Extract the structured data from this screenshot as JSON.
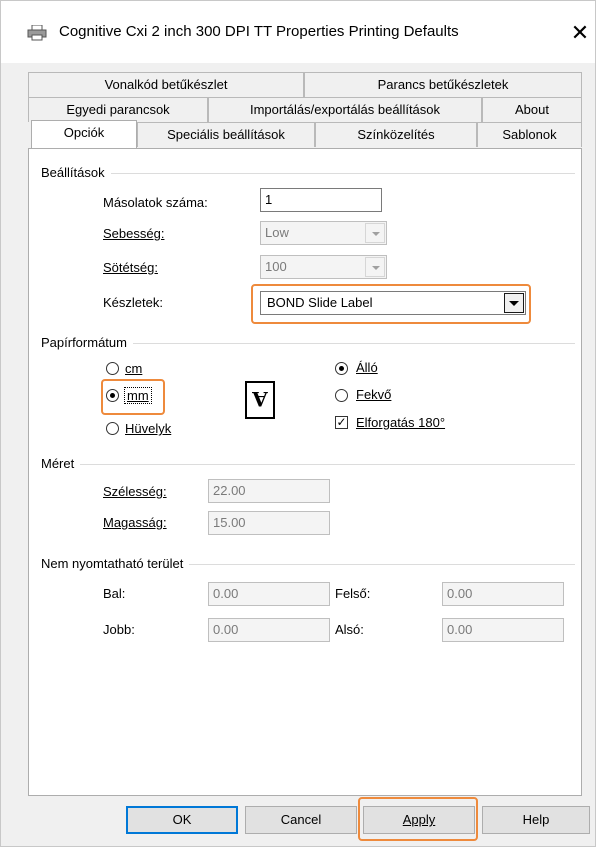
{
  "window": {
    "title": "Cognitive Cxi 2 inch 300 DPI TT Properties Printing Defaults",
    "close_glyph": "✕",
    "icon": "printer-icon"
  },
  "tabs": {
    "row1": [
      "Vonalkód betűkészlet",
      "Parancs betűkészletek"
    ],
    "row2": [
      "Egyedi parancsok",
      "Importálás/exportálás beállítások",
      "About"
    ],
    "row3": [
      "Opciók",
      "Speciális beállítások",
      "Színközelítés",
      "Sablonok"
    ],
    "active": "Opciók"
  },
  "settings": {
    "group_title": "Beállítások",
    "copies_label": "Másolatok száma:",
    "copies_value": "1",
    "speed_label": "Sebesség:",
    "speed_value": "Low",
    "darkness_label": "Sötétség:",
    "darkness_value": "100",
    "stocks_label": "Készletek:",
    "stocks_value": "BOND Slide Label"
  },
  "paper": {
    "group_title": "Papírformátum",
    "unit_cm": "cm",
    "unit_mm": "mm",
    "unit_inch": "Hüvelyk",
    "selected_unit": "mm",
    "orientation_portrait": "Álló",
    "orientation_landscape": "Fekvő",
    "selected_orientation": "Álló",
    "rotate_label": "Elforgatás 180°",
    "rotate_checked": true,
    "check_glyph": "✓",
    "orientation_glyph": "A"
  },
  "size": {
    "group_title": "Méret",
    "width_label": "Szélesség:",
    "width_value": "22.00",
    "height_label": "Magasság:",
    "height_value": "15.00"
  },
  "unprintable": {
    "group_title": "Nem nyomtatható terület",
    "left_label": "Bal:",
    "left_value": "0.00",
    "top_label": "Felső:",
    "top_value": "0.00",
    "right_label": "Jobb:",
    "right_value": "0.00",
    "bottom_label": "Alsó:",
    "bottom_value": "0.00"
  },
  "buttons": {
    "ok": "OK",
    "cancel": "Cancel",
    "apply": "Apply",
    "help": "Help"
  },
  "colors": {
    "highlight": "#ee8a3c",
    "default_button_border": "#0078d7"
  }
}
